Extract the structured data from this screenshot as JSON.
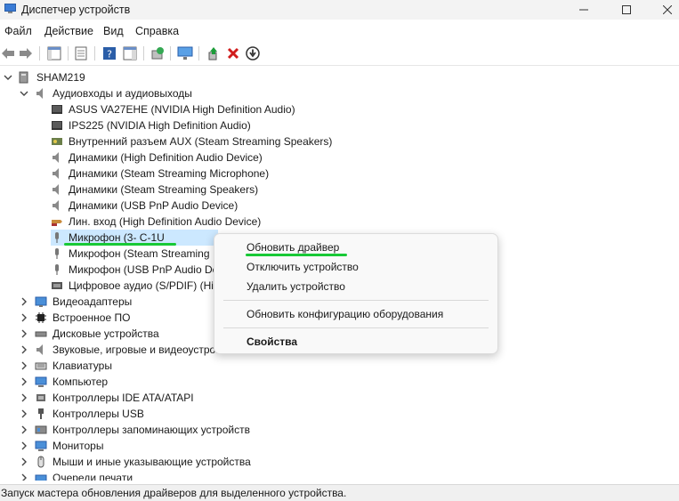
{
  "window": {
    "title": "Диспетчер устройств"
  },
  "menu": [
    "Файл",
    "Действие",
    "Вид",
    "Справка"
  ],
  "tree": {
    "root": "SHAM219",
    "audio_group": "Аудиовходы и аудиовыходы",
    "audio_items": [
      "ASUS VA27EHE (NVIDIA High Definition Audio)",
      "IPS225 (NVIDIA High Definition Audio)",
      "Внутренний разъем  AUX (Steam Streaming Speakers)",
      "Динамики (High Definition Audio Device)",
      "Динамики (Steam Streaming Microphone)",
      "Динамики (Steam Streaming Speakers)",
      "Динамики (USB PnP Audio Device)",
      "Лин. вход (High Definition Audio Device)",
      "Микрофон (3- C-1U",
      "Микрофон (Steam Streaming",
      "Микрофон (USB PnP Audio De",
      "Цифровое аудио (S/PDIF) (Hig"
    ],
    "categories": [
      "Видеоадаптеры",
      "Встроенное ПО",
      "Дисковые устройства",
      "Звуковые, игровые и видеоустройства",
      "Клавиатуры",
      "Компьютер",
      "Контроллеры IDE ATA/ATAPI",
      "Контроллеры USB",
      "Контроллеры запоминающих устройств",
      "Мониторы",
      "Мыши и иные указывающие устройства",
      "Очереди печати"
    ]
  },
  "context_menu": {
    "update": "Обновить драйвер",
    "disable": "Отключить устройство",
    "uninstall": "Удалить устройство",
    "scan": "Обновить конфигурацию оборудования",
    "properties": "Свойства"
  },
  "status": "Запуск мастера обновления драйверов для выделенного устройства.",
  "colors": {
    "selection": "#cce8ff",
    "annotation": "#18c936",
    "danger": "#d01c1c"
  }
}
